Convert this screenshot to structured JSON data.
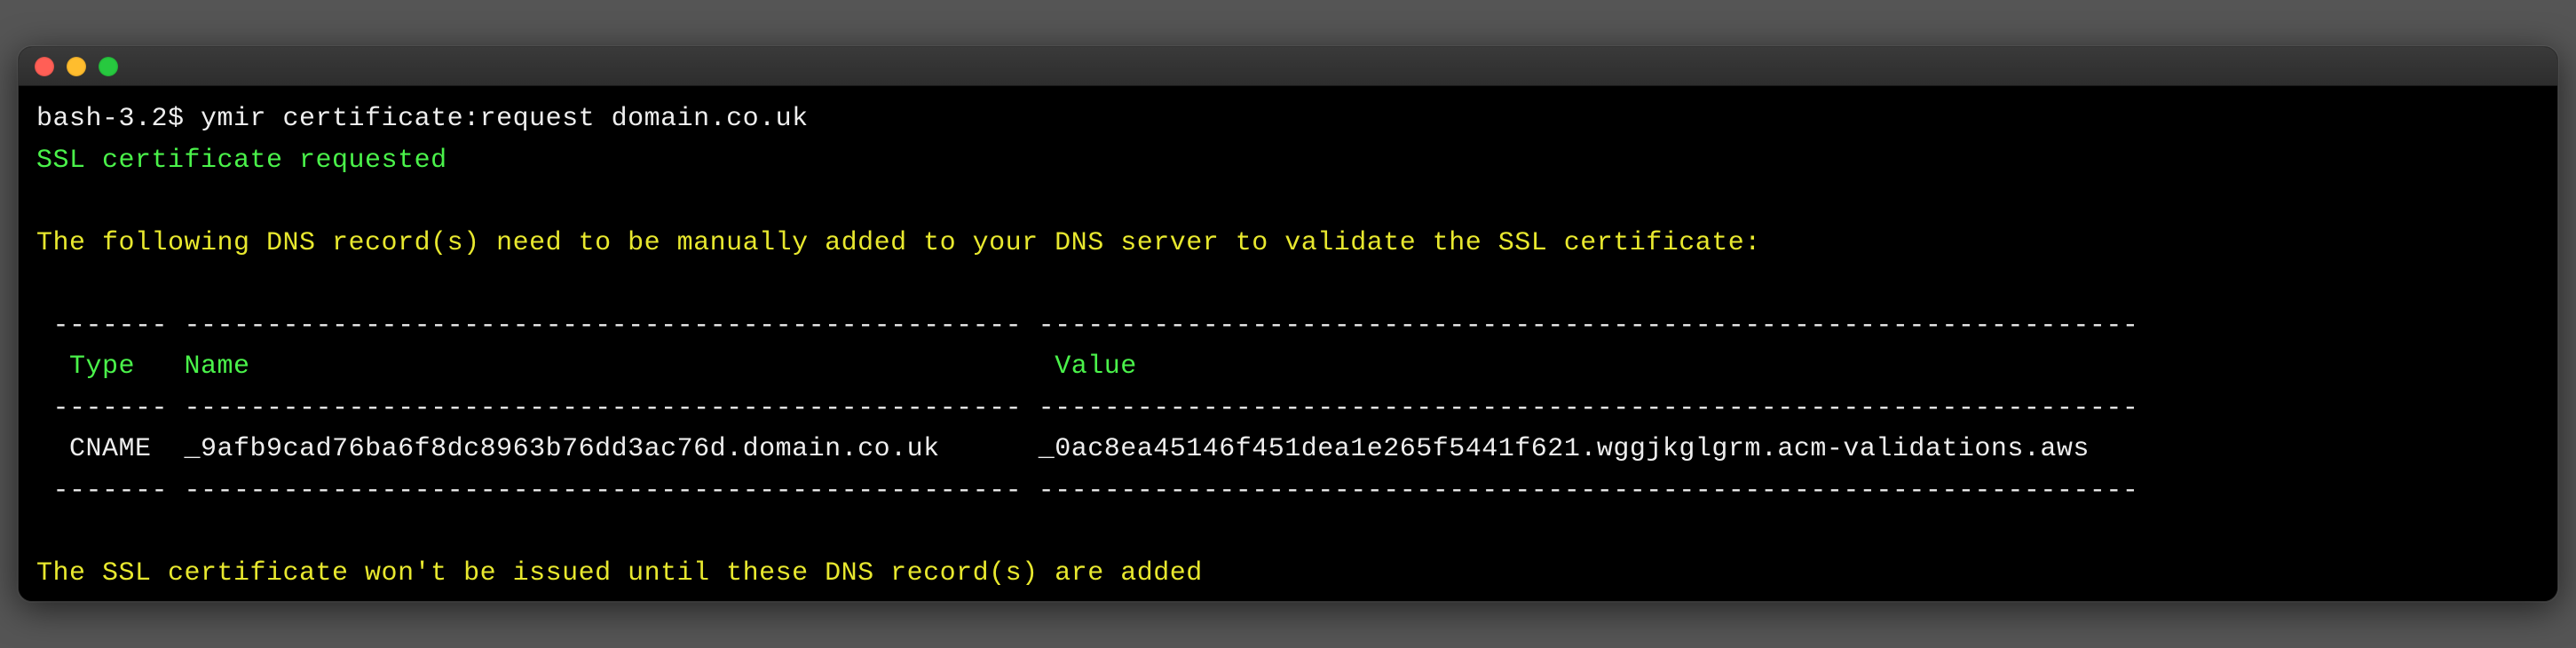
{
  "titlebar": {
    "buttons": [
      "close",
      "minimize",
      "zoom"
    ]
  },
  "prompt": {
    "ps1": "bash-3.2$ ",
    "command": "ymir certificate:request domain.co.uk"
  },
  "output": {
    "success_line": "SSL certificate requested",
    "instruction_line": "The following DNS record(s) need to be manually added to your DNS server to validate the SSL certificate:",
    "footer_line": "The SSL certificate won't be issued until these DNS record(s) are added"
  },
  "table": {
    "sep_top": " ------- --------------------------------------------------- -------------------------------------------------------------------",
    "sep_mid": " ------- --------------------------------------------------- -------------------------------------------------------------------",
    "sep_bottom": " ------- --------------------------------------------------- -------------------------------------------------------------------",
    "header": {
      "col1": "  Type ",
      "col1_pad": "  ",
      "col2": "Name",
      "col2_pad": "                                                 ",
      "col3": "Value"
    },
    "row": {
      "col1": "  CNAME",
      "col1_pad": "  ",
      "col2": "_9afb9cad76ba6f8dc8963b76dd3ac76d.domain.co.uk",
      "col2_pad": "      ",
      "col3": "_0ac8ea45146f451dea1e265f5441f621.wggjkglgrm.acm-validations.aws"
    }
  }
}
